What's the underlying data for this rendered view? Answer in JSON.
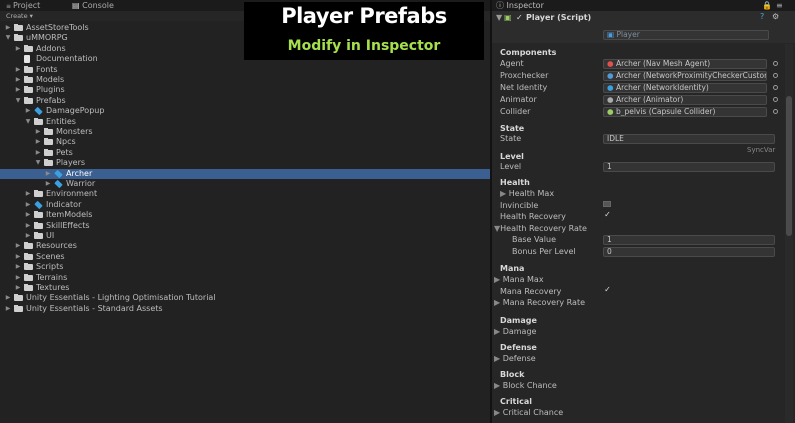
{
  "overlay": {
    "title": "Player Prefabs",
    "subtitle": "Modify in Inspector"
  },
  "project_panel": {
    "tab_project": "Project",
    "tab_console": "Console",
    "create_label": "Create",
    "tree": [
      {
        "label": "AssetStoreTools",
        "icon": "folder-icon",
        "expanded": false
      },
      {
        "label": "uMMORPG",
        "icon": "folder-icon",
        "expanded": true
      },
      {
        "label": "Addons",
        "icon": "folder-icon",
        "expanded": false
      },
      {
        "label": "Documentation",
        "icon": "document-icon",
        "expanded": null
      },
      {
        "label": "Fonts",
        "icon": "folder-icon",
        "expanded": false
      },
      {
        "label": "Models",
        "icon": "folder-icon",
        "expanded": false
      },
      {
        "label": "Plugins",
        "icon": "folder-icon",
        "expanded": false
      },
      {
        "label": "Prefabs",
        "icon": "folder-icon",
        "expanded": true
      },
      {
        "label": "DamagePopup",
        "icon": "prefab-icon",
        "expanded": false
      },
      {
        "label": "Entities",
        "icon": "folder-icon",
        "expanded": true
      },
      {
        "label": "Monsters",
        "icon": "folder-icon",
        "expanded": false
      },
      {
        "label": "Npcs",
        "icon": "folder-icon",
        "expanded": false
      },
      {
        "label": "Pets",
        "icon": "folder-icon",
        "expanded": false
      },
      {
        "label": "Players",
        "icon": "folder-icon",
        "expanded": true
      },
      {
        "label": "Archer",
        "icon": "prefab-icon",
        "expanded": false,
        "selected": true
      },
      {
        "label": "Warrior",
        "icon": "prefab-icon",
        "expanded": false
      },
      {
        "label": "Environment",
        "icon": "folder-icon",
        "expanded": false
      },
      {
        "label": "Indicator",
        "icon": "prefab-icon",
        "expanded": false
      },
      {
        "label": "ItemModels",
        "icon": "folder-icon",
        "expanded": false
      },
      {
        "label": "SkillEffects",
        "icon": "folder-icon",
        "expanded": false
      },
      {
        "label": "UI",
        "icon": "folder-icon",
        "expanded": false
      },
      {
        "label": "Resources",
        "icon": "folder-icon",
        "expanded": false
      },
      {
        "label": "Scenes",
        "icon": "folder-icon",
        "expanded": false
      },
      {
        "label": "Scripts",
        "icon": "folder-icon",
        "expanded": false
      },
      {
        "label": "Terrains",
        "icon": "folder-icon",
        "expanded": false
      },
      {
        "label": "Textures",
        "icon": "folder-icon",
        "expanded": false
      },
      {
        "label": "Unity Essentials - Lighting Optimisation Tutorial",
        "icon": "folder-icon",
        "expanded": false
      },
      {
        "label": "Unity Essentials - Standard Assets",
        "icon": "folder-icon",
        "expanded": false
      }
    ]
  },
  "inspector": {
    "tab_label": "Inspector",
    "component_title": "Player (Script)",
    "script_value": "Player",
    "sections": {
      "components": "Components",
      "state": "State",
      "level": "Level",
      "health": "Health",
      "mana": "Mana",
      "damage": "Damage",
      "defense": "Defense",
      "block": "Block",
      "critical": "Critical"
    },
    "refs": [
      {
        "label": "Agent",
        "value": "Archer (Nav Mesh Agent)"
      },
      {
        "label": "Proxchecker",
        "value": "Archer (NetworkProximityCheckerCustom)"
      },
      {
        "label": "Net Identity",
        "value": "Archer (NetworkIdentity)"
      },
      {
        "label": "Animator",
        "value": "Archer (Animator)"
      },
      {
        "label": "Collider",
        "value": "b_pelvis (Capsule Collider)"
      }
    ],
    "state_label": "State",
    "state_value": "IDLE",
    "syncvar": "SyncVar",
    "level_label": "Level",
    "level_value": "1",
    "health_max": "Health Max",
    "invincible": "Invincible",
    "health_recovery": "Health Recovery",
    "health_recovery_rate": "Health Recovery Rate",
    "base_value_label": "Base Value",
    "base_value": "1",
    "bonus_per_level_label": "Bonus Per Level",
    "bonus_per_level": "0",
    "mana_max": "Mana Max",
    "mana_recovery": "Mana Recovery",
    "mana_recovery_rate": "Mana Recovery Rate",
    "damage_label": "Damage",
    "defense_label": "Defense",
    "block_chance": "Block Chance",
    "critical_chance": "Critical Chance",
    "checks": {
      "invincible": false,
      "health_recovery": true,
      "mana_recovery": true
    }
  }
}
